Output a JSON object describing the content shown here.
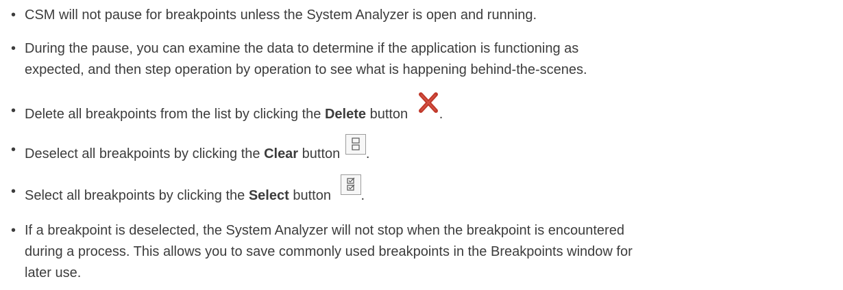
{
  "bullets": [
    {
      "text": "CSM will not pause for breakpoints unless the System Analyzer is open and running."
    },
    {
      "line1": "During the pause, you can examine the data to determine if the application is functioning as",
      "line2": "expected, and then step operation by operation to see what is happening behind-the-scenes."
    },
    {
      "pre": "Delete all breakpoints from the list by clicking the ",
      "bold": "Delete",
      "post": " button",
      "end": ".",
      "icon": "delete-x-icon",
      "icon_color": "#c0392b"
    },
    {
      "pre": "Deselect all breakpoints by clicking the ",
      "bold": "Clear",
      "post": " button",
      "end": ".",
      "icon": "clear-checkbox-icon"
    },
    {
      "pre": "Select all breakpoints by clicking the ",
      "bold": "Select",
      "post": " button",
      "end": ".",
      "icon": "select-checkbox-icon"
    },
    {
      "line1": "If a breakpoint is deselected, the System Analyzer will not stop when the breakpoint is encountered",
      "line2": "during a process. This allows you to save commonly used breakpoints in the Breakpoints window for",
      "line3": "later use."
    }
  ],
  "bullet_char": "•"
}
